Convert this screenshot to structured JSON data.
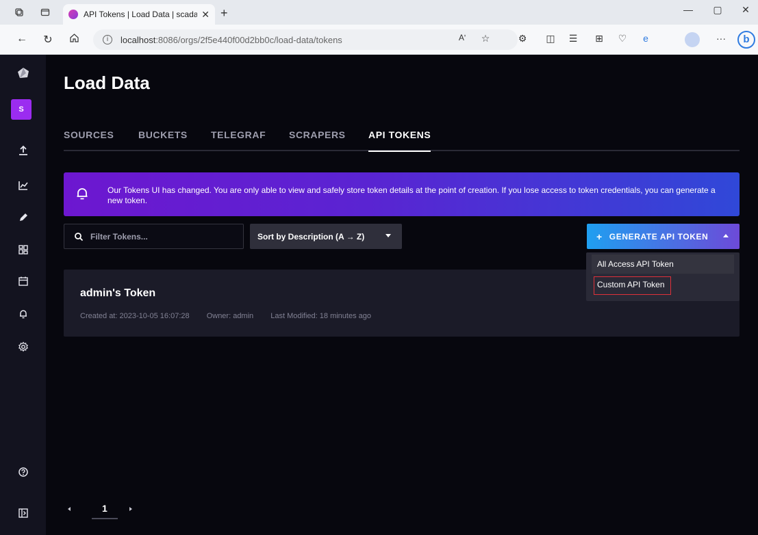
{
  "browser": {
    "tab_title": "API Tokens | Load Data | scada | I",
    "url_host": "localhost",
    "url_path": ":8086/orgs/2f5e440f00d2bb0c/load-data/tokens",
    "read_aloud": "Aʹ"
  },
  "sidebar": {
    "org_initial": "S"
  },
  "page": {
    "title": "Load Data"
  },
  "tabs": [
    "SOURCES",
    "BUCKETS",
    "TELEGRAF",
    "SCRAPERS",
    "API TOKENS"
  ],
  "banner": {
    "text": "Our Tokens UI has changed. You are only able to view and safely store token details at the point of creation. If you lose access to token credentials, you can generate a new token."
  },
  "toolbar": {
    "filter_placeholder": "Filter Tokens...",
    "sort_label": "Sort by Description (A → Z)",
    "generate_label": "GENERATE API TOKEN",
    "generate_plus": "+"
  },
  "dropdown": {
    "items": [
      "All Access API Token",
      "Custom API Token"
    ]
  },
  "tokens": [
    {
      "name": "admin's Token",
      "created": "Created at: 2023-10-05 16:07:28",
      "owner": "Owner: admin",
      "modified": "Last Modified: 18 minutes ago"
    }
  ],
  "pagination": {
    "current_page": "1"
  },
  "colors": {
    "app_bg": "#07070e",
    "sidebar_bg": "#13131f",
    "org_badge": "#9b2cf0",
    "banner_gradient_start": "#6d17d0",
    "banner_gradient_end": "#3048d8",
    "generate_gradient_start": "#1f9ff0",
    "generate_gradient_end": "#6d4ad8",
    "highlight_outline": "#e0313a"
  }
}
